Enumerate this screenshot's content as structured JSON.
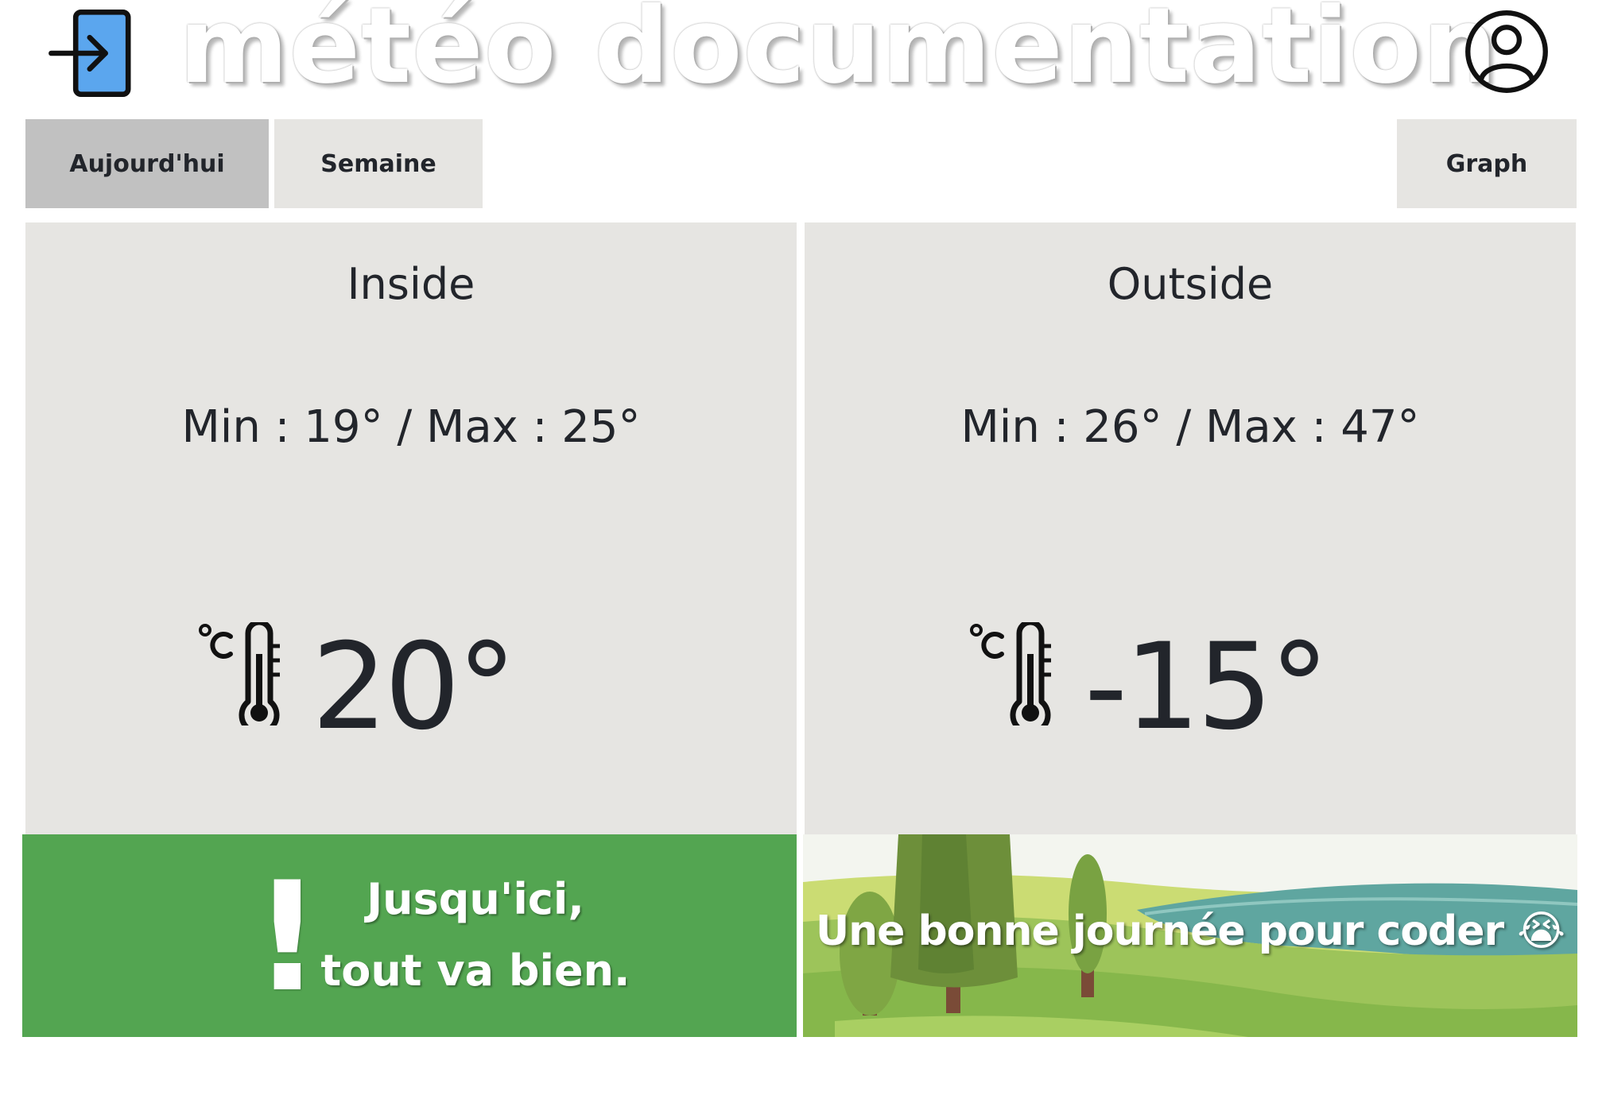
{
  "header": {
    "title": "météo documentation",
    "login_icon": "login-icon",
    "account_icon": "user-account-icon"
  },
  "tabs": [
    {
      "label": "Aujourd'hui",
      "active": true
    },
    {
      "label": "Semaine",
      "active": false
    },
    {
      "label": "Graph",
      "active": false
    }
  ],
  "inside": {
    "title": "Inside",
    "minmax": "Min : 19° / Max : 25°",
    "temperature": "20°",
    "icon": "thermometer-celsius-icon"
  },
  "outside": {
    "title": "Outside",
    "minmax": "Min : 26° / Max : 47°",
    "temperature": "-15°",
    "icon": "thermometer-celsius-icon"
  },
  "alert_banner": {
    "line1": "Jusqu'ici,",
    "line2": "tout va bien.",
    "icon": "exclamation-icon",
    "color": "#53a551"
  },
  "scene_banner": {
    "message": "Une bonne journée pour coder 😭"
  },
  "colors": {
    "tab_active": "#c1c1c1",
    "panel_bg": "#e6e5e2",
    "text": "#22252b",
    "login_accent": "#5ba6ee"
  }
}
